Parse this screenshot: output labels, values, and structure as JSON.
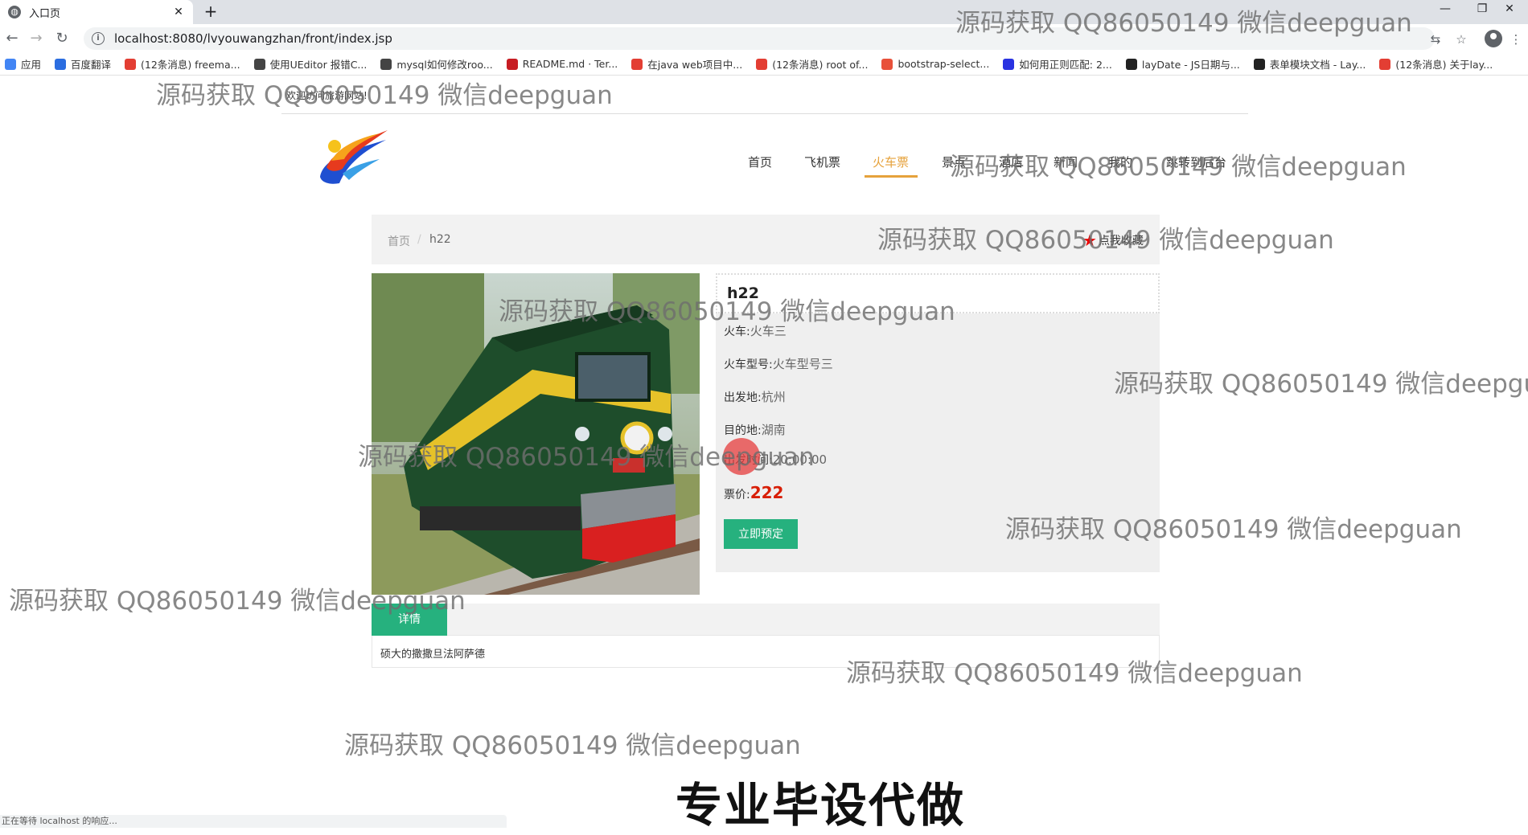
{
  "browser": {
    "tab_title": "入口页",
    "tab_close": "✕",
    "new_tab": "+",
    "url": "localhost:8080/lvyouwangzhan/front/index.jsp",
    "window_controls": [
      "—",
      "❐",
      "✕"
    ],
    "bookmarks": [
      {
        "label": "应用",
        "icon": "apps-grid-icon",
        "color": "#4285f4"
      },
      {
        "label": "百度翻译",
        "icon": "baidu-translate-icon",
        "color": "#2b6de0"
      },
      {
        "label": "(12条消息) freema...",
        "icon": "csdn-icon",
        "color": "#e33e33"
      },
      {
        "label": "使用UEditor 报错C...",
        "icon": "leaf-icon",
        "color": "#444444"
      },
      {
        "label": "mysql如何修改roo...",
        "icon": "leaf-icon",
        "color": "#444444"
      },
      {
        "label": "README.md · Ter...",
        "icon": "gitee-icon",
        "color": "#c71d23"
      },
      {
        "label": "在java web项目中...",
        "icon": "csdn-icon",
        "color": "#e33e33"
      },
      {
        "label": "(12条消息) root of...",
        "icon": "csdn-icon",
        "color": "#e33e33"
      },
      {
        "label": "bootstrap-select...",
        "icon": "bootstrap-icon",
        "color": "#e8513a"
      },
      {
        "label": "如何用正则匹配: 2...",
        "icon": "baidu-paw-icon",
        "color": "#2932e1"
      },
      {
        "label": "layDate - JS日期与...",
        "icon": "layui-icon",
        "color": "#222222"
      },
      {
        "label": "表单模块文档 - Lay...",
        "icon": "layui-icon",
        "color": "#222222"
      },
      {
        "label": "(12条消息) 关于lay...",
        "icon": "csdn-icon",
        "color": "#e33e33"
      }
    ],
    "status_text": "正在等待 localhost 的响应..."
  },
  "site": {
    "welcome": "欢迎访问旅游网站!",
    "nav": [
      {
        "label": "首页",
        "active": false
      },
      {
        "label": "飞机票",
        "active": false
      },
      {
        "label": "火车票",
        "active": true
      },
      {
        "label": "景点",
        "active": false
      },
      {
        "label": "酒店",
        "active": false
      },
      {
        "label": "新闻",
        "active": false
      },
      {
        "label": "我的",
        "active": false
      },
      {
        "label": "跳转到后台",
        "active": false
      }
    ],
    "accent_color": "#e6a23c",
    "button_color": "#26b17e"
  },
  "breadcrumb": {
    "home": "首页",
    "sep": "/",
    "current": "h22"
  },
  "favorite": {
    "icon": "★",
    "label": "点我收藏"
  },
  "ticket": {
    "name": "h22",
    "fields": [
      {
        "label": "火车:",
        "value": "火车三"
      },
      {
        "label": "火车型号:",
        "value": "火车型号三"
      },
      {
        "label": "出发地:",
        "value": "杭州"
      },
      {
        "label": "目的地:",
        "value": "湖南"
      },
      {
        "label": "出发时间:",
        "value": "20:00:00"
      }
    ],
    "price_label": "票价:",
    "price": "222",
    "book_button": "立即预定"
  },
  "details": {
    "tab": "详情",
    "text": "硕大的撒撒旦法阿萨德"
  },
  "overlay": {
    "watermark": "源码获取 QQ86050149 微信deepguan",
    "watermark_cut": "源码获取 QQ86050149 微信deepgua",
    "promo": "专业毕设代做"
  }
}
